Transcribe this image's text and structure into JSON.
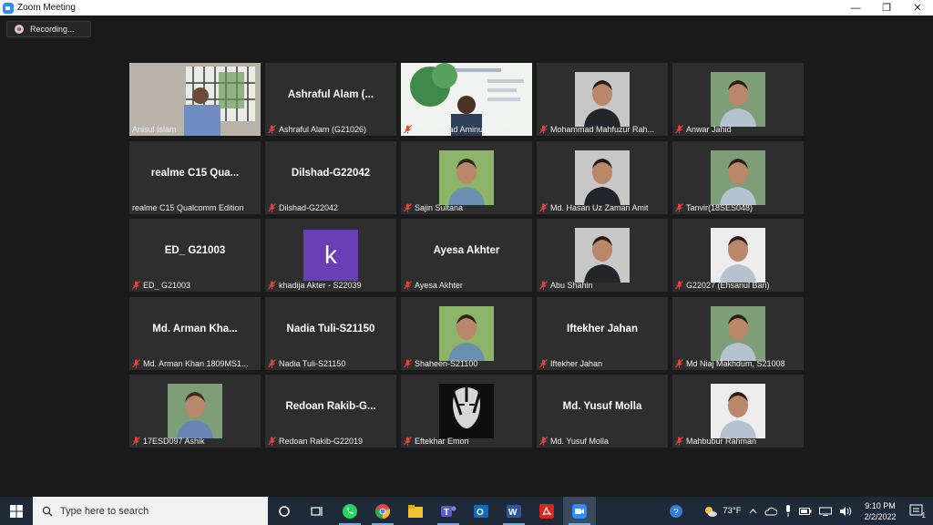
{
  "window": {
    "title": "Zoom Meeting",
    "controls": [
      "—",
      "❐",
      "✕"
    ]
  },
  "recording": {
    "label": "Recording..."
  },
  "participants": [
    {
      "label": "Anisul Islam",
      "big": "",
      "kind": "video-window",
      "muted": false,
      "active": true
    },
    {
      "label": "Ashraful Alam (G21026)",
      "big": "Ashraful Alam (...",
      "kind": "name",
      "muted": true
    },
    {
      "label": "Mohammad Aminur Rahm...",
      "big": "",
      "kind": "video-slide",
      "muted": true
    },
    {
      "label": "Mohammad Mahfuzur Rah...",
      "big": "",
      "kind": "photo",
      "muted": true
    },
    {
      "label": "Anwar Jahid",
      "big": "",
      "kind": "photo-outdoor",
      "muted": true
    },
    {
      "label": "realme C15 Qualcomm Edition",
      "big": "realme C15 Qua...",
      "kind": "name",
      "muted": false
    },
    {
      "label": "Dilshad-G22042",
      "big": "Dilshad-G22042",
      "kind": "name",
      "muted": true
    },
    {
      "label": "Sajin Sultana",
      "big": "",
      "kind": "photo",
      "muted": true
    },
    {
      "label": "Md. Hasan Uz Zaman Amit",
      "big": "",
      "kind": "photo",
      "muted": true
    },
    {
      "label": "Tanvir(18SES048)",
      "big": "",
      "kind": "photo-outdoor",
      "muted": true
    },
    {
      "label": "ED_ G21003",
      "big": "ED_ G21003",
      "kind": "name",
      "muted": true
    },
    {
      "label": "khadija Akter - S22039",
      "big": "k",
      "kind": "avatar",
      "muted": true
    },
    {
      "label": "Ayesa Akhter",
      "big": "Ayesa Akhter",
      "kind": "name",
      "muted": true
    },
    {
      "label": "Abu Shahin",
      "big": "",
      "kind": "photo",
      "muted": true
    },
    {
      "label": "G22027 (Ehsanul Bari)",
      "big": "",
      "kind": "photo",
      "muted": true
    },
    {
      "label": "Md. Arman Khan 1809MS1...",
      "big": "Md. Arman Kha...",
      "kind": "name",
      "muted": true
    },
    {
      "label": "Nadia Tuli-S21150",
      "big": "Nadia Tuli-S21150",
      "kind": "name",
      "muted": true
    },
    {
      "label": "Shaheen-S21100",
      "big": "",
      "kind": "photo",
      "muted": true
    },
    {
      "label": "Iftekher Jahan",
      "big": "Iftekher Jahan",
      "kind": "name",
      "muted": true
    },
    {
      "label": "Md Niaj Makhdum, S21008",
      "big": "",
      "kind": "photo-outdoor",
      "muted": true
    },
    {
      "label": "17ESD097 Ashik",
      "big": "",
      "kind": "photo-outdoor",
      "muted": true
    },
    {
      "label": "Redoan Rakib-G22019",
      "big": "Redoan  Rakib-G...",
      "kind": "name",
      "muted": true
    },
    {
      "label": "Eftekhar Emon",
      "big": "",
      "kind": "photo-bw",
      "muted": true
    },
    {
      "label": "Md. Yusuf Molla",
      "big": "Md. Yusuf Molla",
      "kind": "name",
      "muted": true
    },
    {
      "label": "Mahbubur Rahman",
      "big": "",
      "kind": "photo",
      "muted": true
    }
  ],
  "taskbar": {
    "search_placeholder": "Type here to search",
    "apps": [
      "task-view-icon",
      "whatsapp-icon",
      "chrome-icon",
      "file-explorer-icon",
      "teams-icon",
      "outlook-icon",
      "word-icon",
      "acrobat-icon",
      "zoom-icon"
    ],
    "weather": "73°F",
    "time": "9:10 PM",
    "date": "2/2/2022",
    "notifications": "1"
  },
  "colors": {
    "active_speaker": "#c7e34b",
    "muted_icon": "#e0453a",
    "avatar_purple": "#6a3fb5",
    "zoom_blue": "#2d8cff"
  }
}
